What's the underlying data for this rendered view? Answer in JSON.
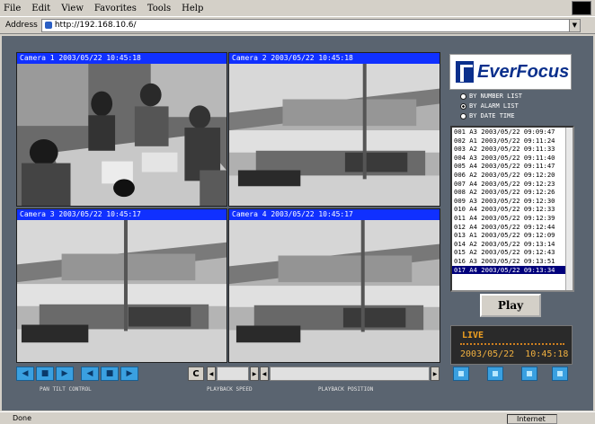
{
  "browser": {
    "menu": [
      "File",
      "Edit",
      "View",
      "Favorites",
      "Tools",
      "Help"
    ],
    "address_label": "Address",
    "address_value": "http://192.168.10.6/",
    "status_text": "Done",
    "zone_text": "Internet"
  },
  "cameras": [
    {
      "title": "Camera 1 2003/05/22 10:45:18"
    },
    {
      "title": "Camera 2 2003/05/22 10:45:18"
    },
    {
      "title": "Camera 3 2003/05/22 10:45:17"
    },
    {
      "title": "Camera 4 2003/05/22 10:45:17"
    }
  ],
  "brand": {
    "name": "EverFocus",
    "reg": "®"
  },
  "list_options": [
    {
      "label": "BY NUMBER LIST",
      "selected": false
    },
    {
      "label": "BY ALARM LIST",
      "selected": true
    },
    {
      "label": "BY DATE TIME",
      "selected": false
    }
  ],
  "events": [
    "001 A3 2003/05/22 09:09:47",
    "002 A1 2003/05/22 09:11:24",
    "003 A2 2003/05/22 09:11:33",
    "004 A3 2003/05/22 09:11:40",
    "005 A4 2003/05/22 09:11:47",
    "006 A2 2003/05/22 09:12:20",
    "007 A4 2003/05/22 09:12:23",
    "008 A2 2003/05/22 09:12:26",
    "009 A3 2003/05/22 09:12:30",
    "010 A4 2003/05/22 09:12:33",
    "011 A4 2003/05/22 09:12:39",
    "012 A4 2003/05/22 09:12:44",
    "013 A1 2003/05/22 09:12:09",
    "014 A2 2003/05/22 09:13:14",
    "015 A2 2003/05/22 09:12:43",
    "016 A3 2003/05/22 09:13:51",
    "017 A4 2003/05/22 09:13:34"
  ],
  "selected_event_index": 16,
  "play_label": "Play",
  "status_panel": {
    "mode": "LIVE",
    "date": "2003/05/22",
    "time": "10:45:18"
  },
  "controls": {
    "pan_tilt_label": "PAN TILT CONTROL",
    "playback_speed_label": "PLAYBACK SPEED",
    "playback_position_label": "PLAYBACK POSITION",
    "clear_label": "C"
  }
}
